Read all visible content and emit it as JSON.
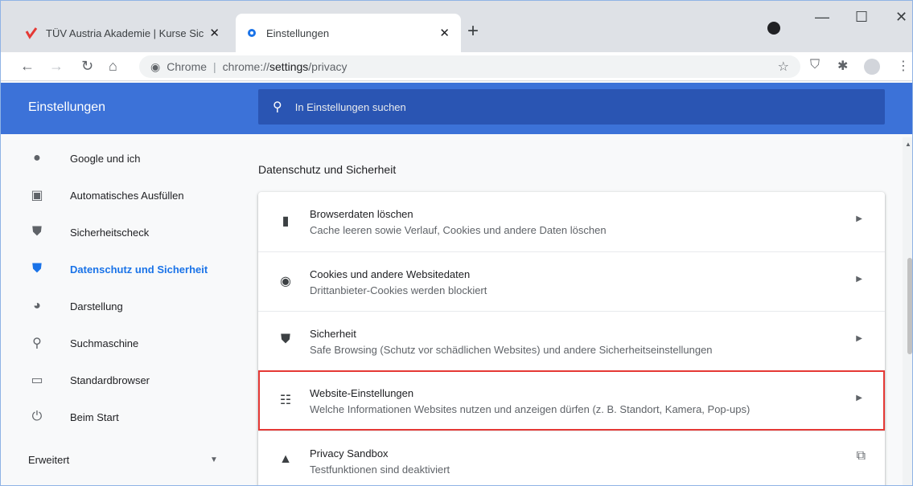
{
  "browser": {
    "tabs": [
      {
        "label": "TÜV Austria Akademie | Kurse Sic",
        "icon": "tuv-logo-icon",
        "close": "✕"
      },
      {
        "label": "Einstellungen",
        "icon": "gear-icon",
        "close": "✕"
      }
    ],
    "new_tab": "+",
    "window_controls": {
      "minimize": "—",
      "maximize": "☐",
      "close": "✕"
    },
    "address": {
      "chip": "Chrome",
      "separator": "|",
      "url_prefix": "chrome://",
      "url_main": "settings",
      "url_suffix": "/privacy"
    }
  },
  "header": {
    "title": "Einstellungen",
    "search_placeholder": "In Einstellungen suchen"
  },
  "sidebar": {
    "items": [
      {
        "label": "Google und ich",
        "icon": "person-icon",
        "active": false
      },
      {
        "label": "Automatisches Ausfüllen",
        "icon": "clipboard-icon",
        "active": false
      },
      {
        "label": "Sicherheitscheck",
        "icon": "shield-check-icon",
        "active": false
      },
      {
        "label": "Datenschutz und Sicherheit",
        "icon": "shield-icon",
        "active": true
      },
      {
        "label": "Darstellung",
        "icon": "palette-icon",
        "active": false
      },
      {
        "label": "Suchmaschine",
        "icon": "search-icon",
        "active": false
      },
      {
        "label": "Standardbrowser",
        "icon": "browser-icon",
        "active": false
      },
      {
        "label": "Beim Start",
        "icon": "power-icon",
        "active": false
      }
    ],
    "advanced": "Erweitert"
  },
  "main": {
    "section_title": "Datenschutz und Sicherheit",
    "rows": [
      {
        "title": "Browserdaten löschen",
        "subtitle": "Cache leeren sowie Verlauf, Cookies und andere Daten löschen",
        "icon": "trash-icon"
      },
      {
        "title": "Cookies und andere Websitedaten",
        "subtitle": "Drittanbieter-Cookies werden blockiert",
        "icon": "cookie-icon"
      },
      {
        "title": "Sicherheit",
        "subtitle": "Safe Browsing (Schutz vor schädlichen Websites) und andere Sicherheitseinstellungen",
        "icon": "shield-icon"
      },
      {
        "title": "Website-Einstellungen",
        "subtitle": "Welche Informationen Websites nutzen und anzeigen dürfen (z. B. Standort, Kamera, Pop-ups)",
        "icon": "tune-icon"
      },
      {
        "title": "Privacy Sandbox",
        "subtitle": "Testfunktionen sind deaktiviert",
        "icon": "flask-icon"
      }
    ]
  },
  "colors": {
    "header_blue": "#3c72d8",
    "active_blue": "#1a73e8",
    "highlight_red": "#e53935"
  }
}
